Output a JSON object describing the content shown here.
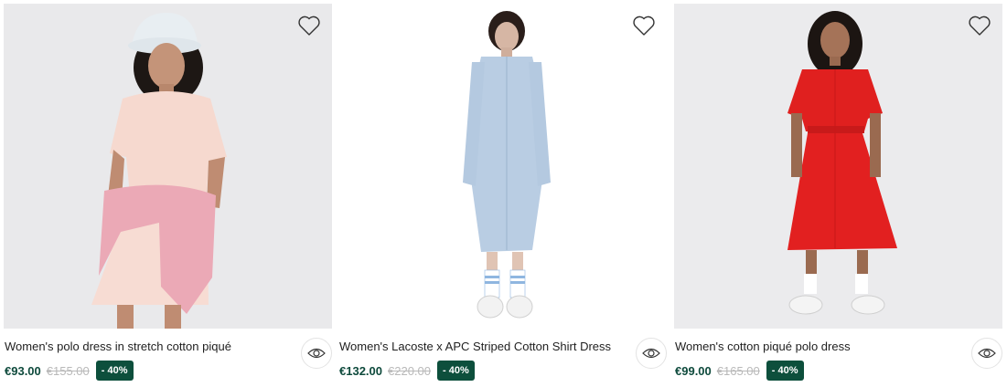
{
  "products": [
    {
      "name": "Women's polo dress in stretch cotton piqué",
      "price": "€93.00",
      "old_price": "€155.00",
      "discount": "- 40%",
      "image_alt": "Model in pink polo dress with bucket hat and sweater tied at waist"
    },
    {
      "name": "Women's Lacoste x APC Striped Cotton Shirt Dress",
      "price": "€132.00",
      "old_price": "€220.00",
      "discount": "- 40%",
      "image_alt": "Model in light blue striped long shirt dress with striped socks"
    },
    {
      "name": "Women's cotton piqué polo dress",
      "price": "€99.00",
      "old_price": "€165.00",
      "discount": "- 40%",
      "image_alt": "Model in red belted polo dress with white sneakers"
    }
  ],
  "icons": {
    "favorite": "heart-icon",
    "quick_view": "eye-icon"
  },
  "colors": {
    "price": "#0e4a3c",
    "badge_bg": "#0d4f3c",
    "old_price": "#b9b9b9"
  }
}
